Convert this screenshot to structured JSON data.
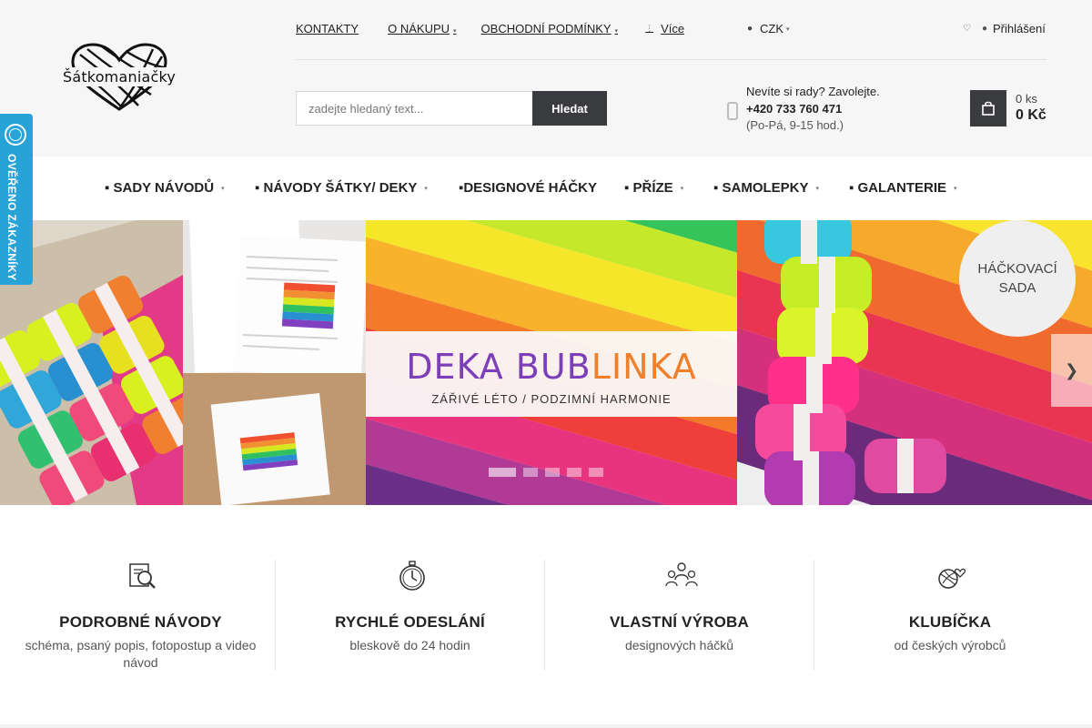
{
  "header": {
    "logo_text": "Šátkomaniačky",
    "top_links": [
      {
        "label": "KONTAKTY",
        "has_caret": false
      },
      {
        "label": "O NÁKUPU",
        "has_caret": true
      },
      {
        "label": "OBCHODNÍ PODMÍNKY",
        "has_caret": true
      },
      {
        "label": "Více",
        "has_caret": false
      }
    ],
    "currency": "CZK",
    "login_label": "Přihlášení",
    "search": {
      "placeholder": "zadejte hledaný text...",
      "button": "Hledat"
    },
    "contact": {
      "line1": "Nevíte si rady? Zavolejte.",
      "phone": "+420 733 760 471",
      "hours": "(Po-Pá, 9-15 hod.)"
    },
    "cart": {
      "count": "0 ks",
      "price": "0 Kč"
    }
  },
  "badge": {
    "text": "OVĚŘENO ZÁKAZNÍKY"
  },
  "main_nav": [
    {
      "label": "▪ SADY NÁVODŮ",
      "has_caret": true
    },
    {
      "label": "▪ NÁVODY ŠÁTKY/ DEKY",
      "has_caret": true
    },
    {
      "label": "▪DESIGNOVÉ HÁČKY",
      "has_caret": false
    },
    {
      "label": "▪ PŘÍZE",
      "has_caret": true
    },
    {
      "label": "▪ SAMOLEPKY",
      "has_caret": true
    },
    {
      "label": "▪ GALANTERIE",
      "has_caret": true
    }
  ],
  "hero": {
    "title_part1": "DEKA BUB",
    "title_part2": "LINKA",
    "subtitle": "ZÁŘIVÉ LÉTO / PODZIMNÍ HARMONIE",
    "badge_line1": "HÁČKOVACÍ",
    "badge_line2": "SADA",
    "slide_count": 5,
    "active_slide": 1
  },
  "features": [
    {
      "icon": "magnifier-document-icon",
      "title": "PODROBNÉ NÁVODY",
      "subtitle": "schéma, psaný popis, fotopostup a video návod"
    },
    {
      "icon": "stopwatch-icon",
      "title": "RYCHLÉ ODESLÁNÍ",
      "subtitle": "bleskově do 24 hodin"
    },
    {
      "icon": "people-icon",
      "title": "VLASTNÍ VÝROBA",
      "subtitle": "designových háčků"
    },
    {
      "icon": "yarn-heart-icon",
      "title": "KLUBÍČKA",
      "subtitle": "od českých výrobců"
    }
  ],
  "colors": {
    "accent_dark": "#3a3b3f",
    "badge_blue": "#27a3d8",
    "banner_purple": "#7d3fb7",
    "banner_orange": "#f07f2a"
  }
}
